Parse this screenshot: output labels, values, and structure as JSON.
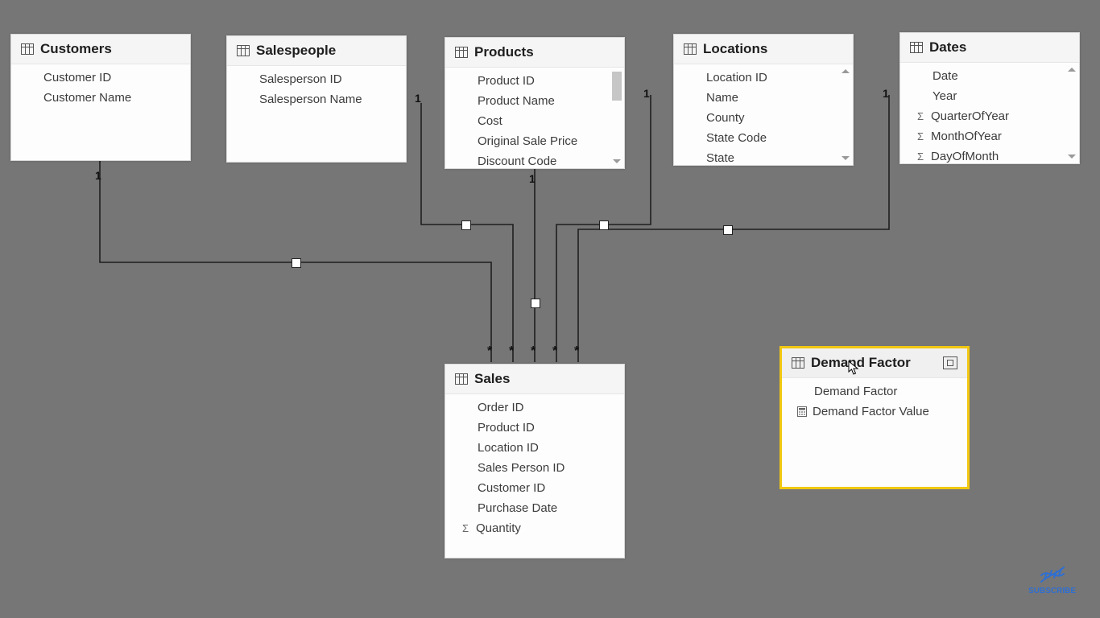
{
  "colors": {
    "canvas": "#767676",
    "card_bg": "#fdfdfd",
    "selected_border": "#f2c811"
  },
  "relationships": [
    {
      "from": "customers",
      "to": "sales",
      "cardinality": "1:*",
      "direction": "single"
    },
    {
      "from": "salespeople",
      "to": "sales",
      "cardinality": "1:*",
      "direction": "single"
    },
    {
      "from": "products",
      "to": "sales",
      "cardinality": "1:*",
      "direction": "single"
    },
    {
      "from": "locations",
      "to": "sales",
      "cardinality": "1:*",
      "direction": "single"
    },
    {
      "from": "dates",
      "to": "sales",
      "cardinality": "1:*",
      "direction": "single"
    }
  ],
  "tables": {
    "customers": {
      "title": "Customers",
      "fields": [
        {
          "label": "Customer ID"
        },
        {
          "label": "Customer Name"
        }
      ]
    },
    "salespeople": {
      "title": "Salespeople",
      "fields": [
        {
          "label": "Salesperson ID"
        },
        {
          "label": "Salesperson Name"
        }
      ]
    },
    "products": {
      "title": "Products",
      "fields": [
        {
          "label": "Product ID"
        },
        {
          "label": "Product Name"
        },
        {
          "label": "Cost"
        },
        {
          "label": "Original Sale Price"
        },
        {
          "label": "Discount Code"
        }
      ]
    },
    "locations": {
      "title": "Locations",
      "fields": [
        {
          "label": "Location ID"
        },
        {
          "label": "Name"
        },
        {
          "label": "County"
        },
        {
          "label": "State Code"
        },
        {
          "label": "State"
        }
      ]
    },
    "dates": {
      "title": "Dates",
      "fields": [
        {
          "label": "Date"
        },
        {
          "label": "Year"
        },
        {
          "label": "QuarterOfYear",
          "icon": "sigma"
        },
        {
          "label": "MonthOfYear",
          "icon": "sigma"
        },
        {
          "label": "DayOfMonth",
          "icon": "sigma"
        }
      ]
    },
    "sales": {
      "title": "Sales",
      "fields": [
        {
          "label": "Order ID"
        },
        {
          "label": "Product ID"
        },
        {
          "label": "Location ID"
        },
        {
          "label": "Sales Person ID"
        },
        {
          "label": "Customer ID"
        },
        {
          "label": "Purchase Date"
        },
        {
          "label": "Quantity",
          "icon": "sigma"
        }
      ]
    },
    "demand_factor": {
      "title": "Demand Factor",
      "fields": [
        {
          "label": "Demand Factor"
        },
        {
          "label": "Demand Factor Value",
          "icon": "calc"
        }
      ]
    }
  },
  "labels": {
    "one1": "1",
    "one2": "1",
    "one3": "1",
    "one4": "1",
    "one5": "1",
    "star1": "*",
    "star2": "*",
    "star3": "*",
    "star4": "*",
    "star5": "*",
    "subscribe": "SUBSCRIBE"
  }
}
